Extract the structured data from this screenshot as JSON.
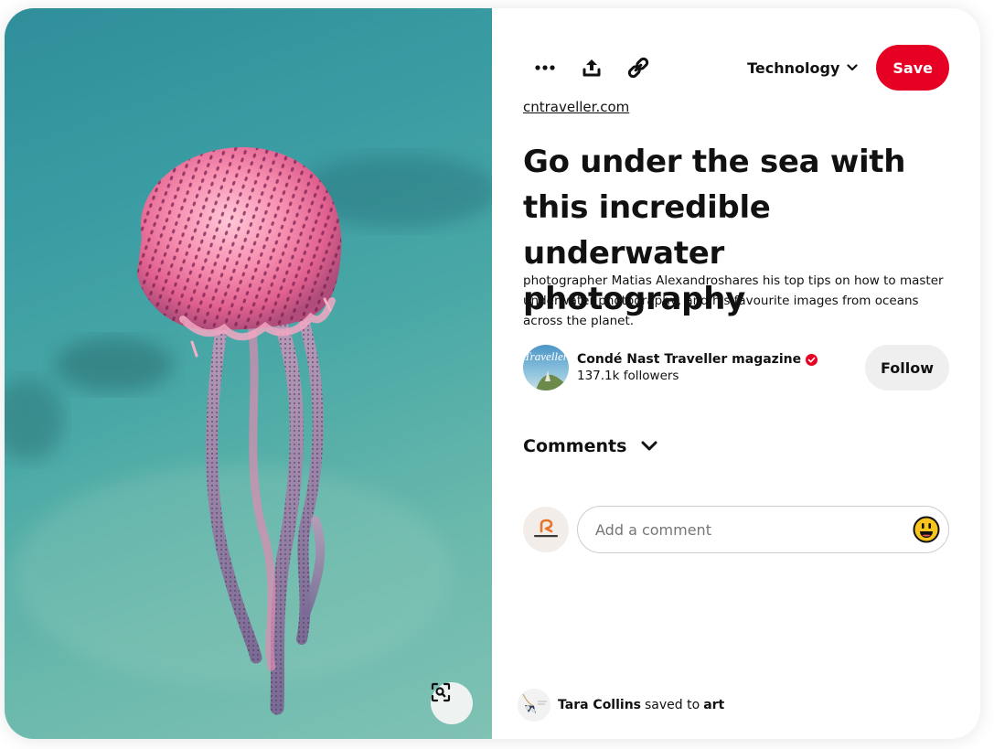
{
  "pin": {
    "image_alt": "Pink spotted jellyfish underwater",
    "lens_icon": "visual-search-icon"
  },
  "toolbar": {
    "more_icon": "more-horizontal-icon",
    "share_icon": "share-upload-icon",
    "link_icon": "link-icon",
    "board_name": "Technology",
    "save_label": "Save",
    "accent_color": "#e60023"
  },
  "source": {
    "domain": "cntraveller.com"
  },
  "title": "Go under the sea with this incredible underwater photography",
  "description": "photographer Matias Alexandroshares his top tips on how to master underwater photography, and his favourite images from oceans across the planet.",
  "creator": {
    "name": "Condé Nast Traveller magazine",
    "verified": true,
    "followers": "137.1k followers",
    "follow_label": "Follow",
    "avatar_text": "Traveller"
  },
  "comments": {
    "header": "Comments",
    "placeholder": "Add a comment",
    "emoji_icon": "smiley-emoji-icon"
  },
  "saved_by": {
    "user": "Tara Collins",
    "action": "saved to",
    "board": "art"
  }
}
